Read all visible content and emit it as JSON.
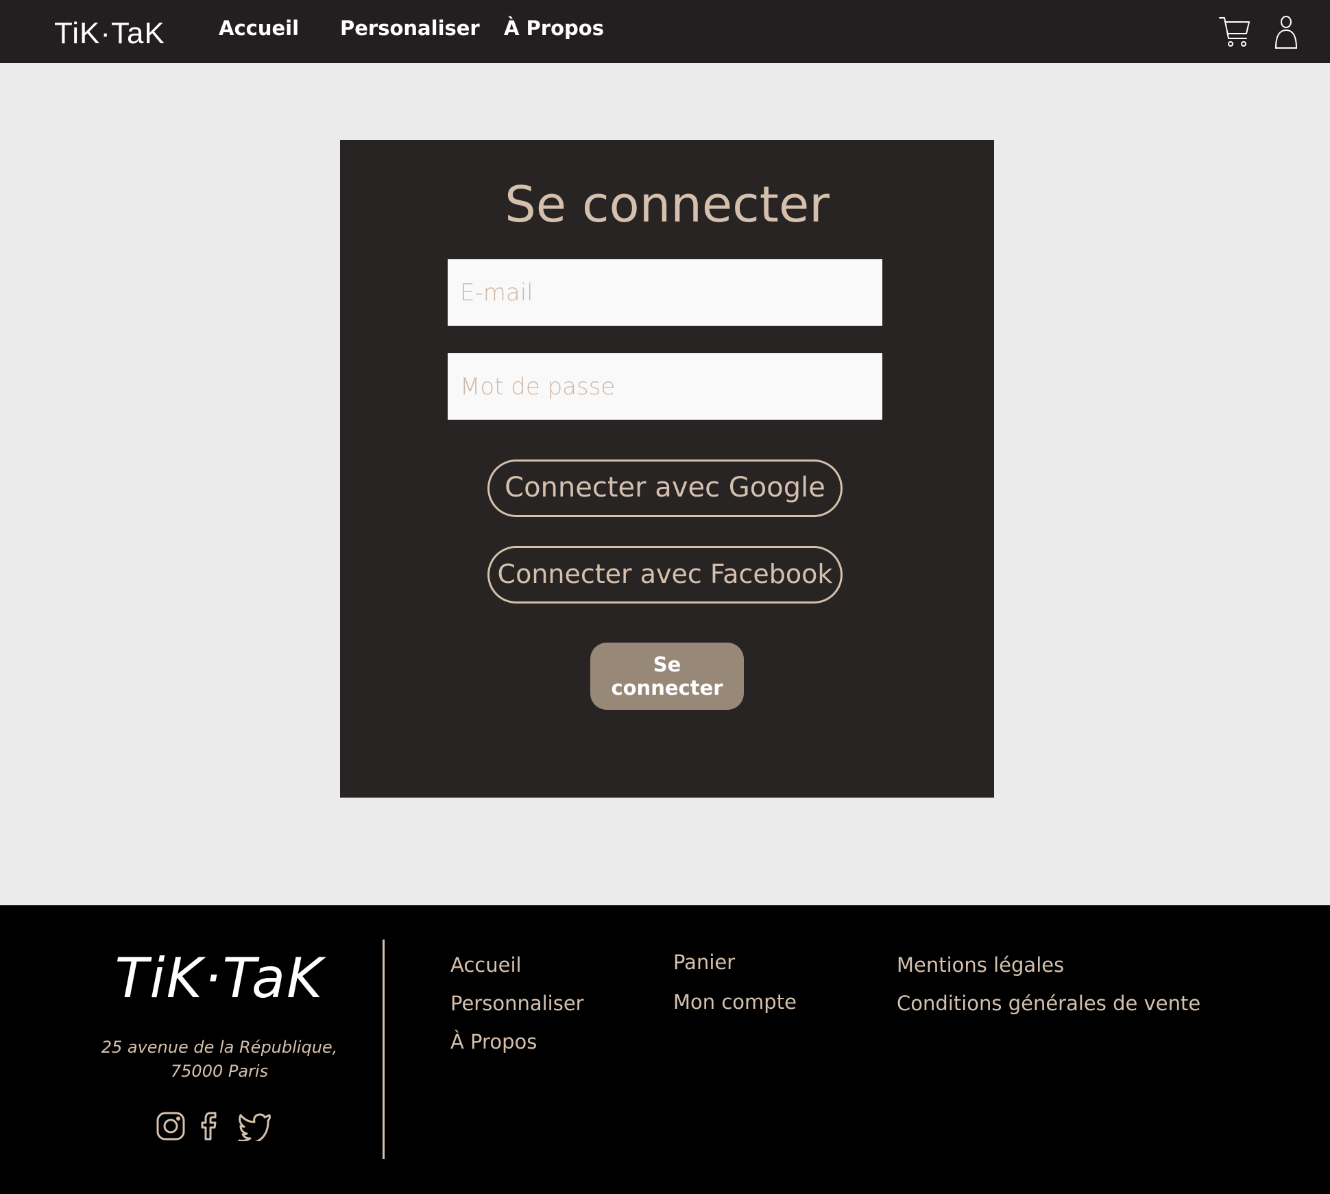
{
  "header": {
    "logo": "TiK·TaK",
    "nav": [
      "Accueil",
      "Personaliser",
      "À Propos"
    ],
    "icons": [
      "cart-icon",
      "user-icon"
    ]
  },
  "login": {
    "title": "Se connecter",
    "email_placeholder": "E-mail",
    "password_placeholder": "Mot de passe",
    "google_button": "Connecter avec Google",
    "facebook_button": "Connecter avec Facebook",
    "submit_button": "Se connecter"
  },
  "footer": {
    "logo": "TiK·TaK",
    "address_line1": "25 avenue de la République,",
    "address_line2": "75000 Paris",
    "social_icons": [
      "instagram-icon",
      "facebook-icon",
      "twitter-icon"
    ],
    "col1": [
      "Accueil",
      "Personnaliser",
      "À Propos"
    ],
    "col2": [
      "Panier",
      "Mon compte"
    ],
    "col3": [
      "Mentions légales",
      "Conditions générales de vente"
    ]
  },
  "colors": {
    "header_bg": "#231f20",
    "page_bg": "#ebebeb",
    "card_bg": "#292424",
    "accent": "#d4c0ad",
    "button_bg": "#988878",
    "footer_bg": "#000000"
  }
}
